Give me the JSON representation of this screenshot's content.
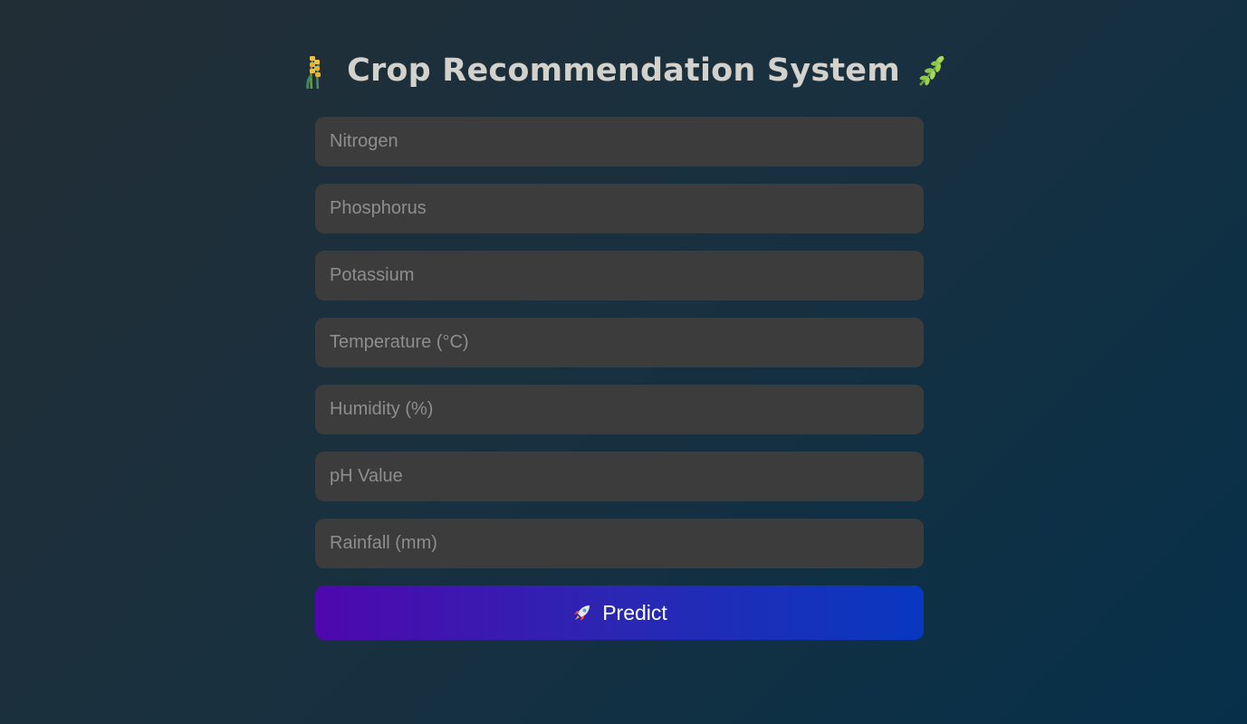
{
  "header": {
    "title": "Crop Recommendation System",
    "left_icon": "wheat-icon",
    "right_icon": "herb-icon"
  },
  "form": {
    "fields": [
      {
        "name": "nitrogen-field",
        "placeholder": "Nitrogen",
        "value": ""
      },
      {
        "name": "phosphorus-field",
        "placeholder": "Phosphorus",
        "value": ""
      },
      {
        "name": "potassium-field",
        "placeholder": "Potassium",
        "value": ""
      },
      {
        "name": "temperature-field",
        "placeholder": "Temperature (°C)",
        "value": ""
      },
      {
        "name": "humidity-field",
        "placeholder": "Humidity (%)",
        "value": ""
      },
      {
        "name": "ph-field",
        "placeholder": "pH Value",
        "value": ""
      },
      {
        "name": "rainfall-field",
        "placeholder": "Rainfall (mm)",
        "value": ""
      }
    ],
    "submit": {
      "label": "Predict",
      "icon": "rocket-icon"
    }
  },
  "colors": {
    "background_start": "#222e36",
    "background_end": "#06304a",
    "field_bg": "#3c3c3c",
    "placeholder": "#8e8e8e",
    "title": "#d3d1cb",
    "button_start": "#4e08ad",
    "button_end": "#0838c0"
  }
}
